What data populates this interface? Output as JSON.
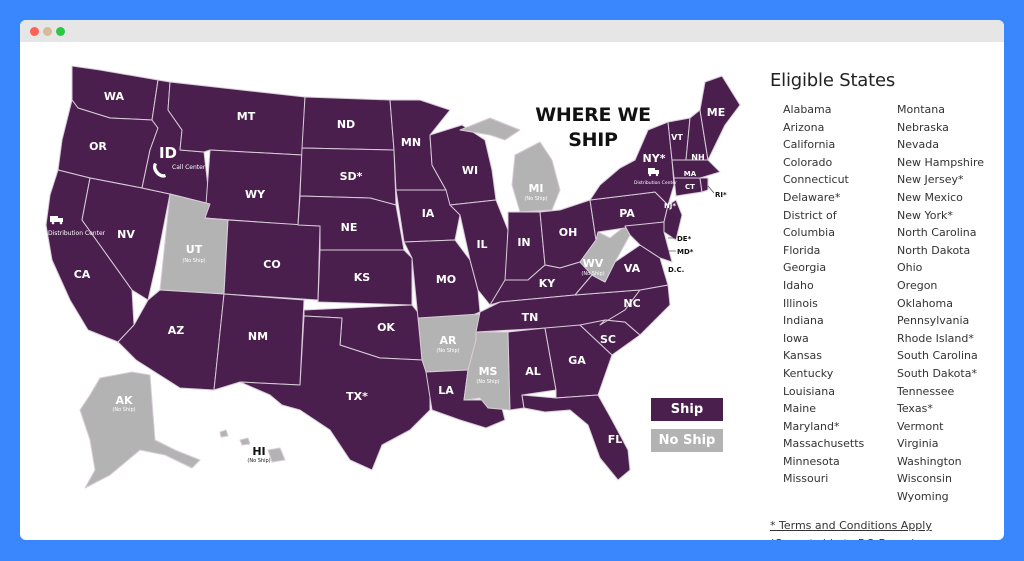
{
  "window": {
    "controls": [
      "close",
      "minimize",
      "maximize"
    ]
  },
  "map": {
    "heading_line1": "WHERE WE",
    "heading_line2": "SHIP",
    "colors": {
      "ship": "#4a1f4e",
      "no_ship": "#b3b3b3",
      "border": "#d9ccd9"
    },
    "no_ship_note": "(No Ship)",
    "states": [
      {
        "abbr": "WA",
        "status": "ship"
      },
      {
        "abbr": "OR",
        "status": "ship"
      },
      {
        "abbr": "CA",
        "status": "ship"
      },
      {
        "abbr": "NV",
        "status": "ship"
      },
      {
        "abbr": "ID",
        "status": "ship"
      },
      {
        "abbr": "MT",
        "status": "ship"
      },
      {
        "abbr": "WY",
        "status": "ship"
      },
      {
        "abbr": "UT",
        "status": "no_ship"
      },
      {
        "abbr": "AZ",
        "status": "ship"
      },
      {
        "abbr": "CO",
        "status": "ship"
      },
      {
        "abbr": "NM",
        "status": "ship"
      },
      {
        "abbr": "ND",
        "status": "ship"
      },
      {
        "abbr": "SD*",
        "status": "ship"
      },
      {
        "abbr": "NE",
        "status": "ship"
      },
      {
        "abbr": "KS",
        "status": "ship"
      },
      {
        "abbr": "OK",
        "status": "ship"
      },
      {
        "abbr": "TX*",
        "status": "ship"
      },
      {
        "abbr": "MN",
        "status": "ship"
      },
      {
        "abbr": "IA",
        "status": "ship"
      },
      {
        "abbr": "MO",
        "status": "ship"
      },
      {
        "abbr": "AR",
        "status": "no_ship"
      },
      {
        "abbr": "LA",
        "status": "ship"
      },
      {
        "abbr": "WI",
        "status": "ship"
      },
      {
        "abbr": "IL",
        "status": "ship"
      },
      {
        "abbr": "MI",
        "status": "no_ship"
      },
      {
        "abbr": "IN",
        "status": "ship"
      },
      {
        "abbr": "OH",
        "status": "ship"
      },
      {
        "abbr": "KY",
        "status": "ship"
      },
      {
        "abbr": "TN",
        "status": "ship"
      },
      {
        "abbr": "MS",
        "status": "no_ship"
      },
      {
        "abbr": "AL",
        "status": "ship"
      },
      {
        "abbr": "GA",
        "status": "ship"
      },
      {
        "abbr": "FL",
        "status": "ship"
      },
      {
        "abbr": "SC",
        "status": "ship"
      },
      {
        "abbr": "NC",
        "status": "ship"
      },
      {
        "abbr": "VA",
        "status": "ship"
      },
      {
        "abbr": "WV",
        "status": "no_ship"
      },
      {
        "abbr": "PA",
        "status": "ship"
      },
      {
        "abbr": "NY*",
        "status": "ship"
      },
      {
        "abbr": "VT",
        "status": "ship"
      },
      {
        "abbr": "NH",
        "status": "ship"
      },
      {
        "abbr": "ME",
        "status": "ship"
      },
      {
        "abbr": "MA",
        "status": "ship"
      },
      {
        "abbr": "CT",
        "status": "ship"
      },
      {
        "abbr": "RI*",
        "status": "ship"
      },
      {
        "abbr": "NJ*",
        "status": "ship"
      },
      {
        "abbr": "DE*",
        "status": "ship"
      },
      {
        "abbr": "MD*",
        "status": "ship"
      },
      {
        "abbr": "D.C.",
        "status": "ship"
      },
      {
        "abbr": "AK",
        "status": "no_ship"
      },
      {
        "abbr": "HI",
        "status": "no_ship"
      }
    ],
    "annotations": {
      "id_call_center": "Call Center",
      "ca_distribution": "Distribution Center",
      "ny_distribution": "Distribution Center"
    },
    "legend": {
      "ship": "Ship",
      "no_ship": "No Ship"
    }
  },
  "sidebar": {
    "title": "Eligible States",
    "left_column": [
      "Alabama",
      "Arizona",
      "California",
      "Colorado",
      "Connecticut",
      "Delaware*",
      "District of",
      "Columbia",
      "Florida",
      "Georgia",
      "Idaho",
      "Illinois",
      "Indiana",
      "Iowa",
      "Kansas",
      "Kentucky",
      "Louisiana",
      "Maine",
      "Maryland*",
      "Massachusetts",
      "Minnesota",
      "Missouri"
    ],
    "right_column": [
      "Montana",
      "Nebraska",
      "Nevada",
      "New Hampshire",
      "New Jersey*",
      "New Mexico",
      "New York*",
      "North Carolina",
      "North Dakota",
      "Ohio",
      "Oregon",
      "Oklahoma",
      "Pennsylvania",
      "Rhode Island*",
      "South Carolina",
      "South Dakota*",
      "Tennessee",
      "Texas*",
      "Vermont",
      "Virginia",
      "Washington",
      "Wisconsin",
      "Wyoming"
    ],
    "terms_link": "* Terms and Conditions Apply",
    "po_box_note": "(Cannot ship to P.O Boxes)"
  }
}
